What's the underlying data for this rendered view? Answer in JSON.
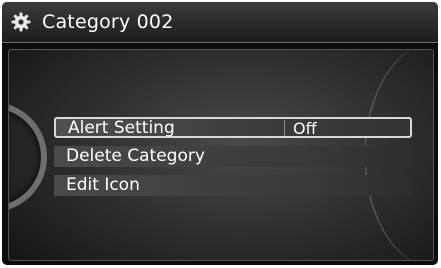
{
  "header": {
    "title": "Category 002",
    "icon": "gear-icon"
  },
  "menu": {
    "items": [
      {
        "label": "Alert Setting",
        "value": "Off",
        "selected": true
      },
      {
        "label": "Delete Category"
      },
      {
        "label": "Edit Icon"
      }
    ]
  }
}
